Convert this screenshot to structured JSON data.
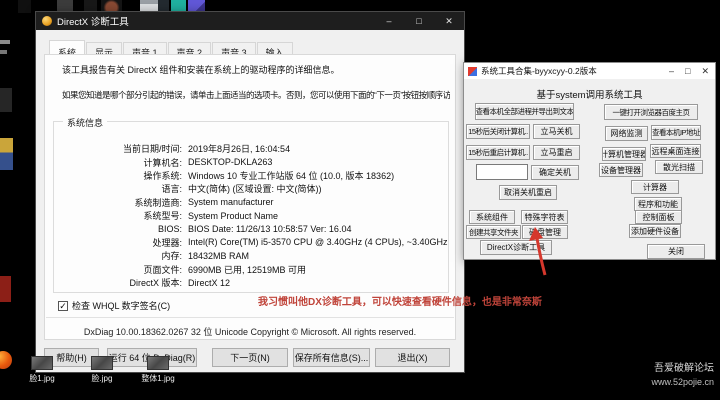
{
  "desktop": {
    "files": [
      "脸1.jpg",
      "脸.jpg",
      "整体1.jpg"
    ],
    "watermark": {
      "line1": "吾爱破解论坛",
      "line2": "www.52pojie.cn"
    }
  },
  "dxdiag": {
    "title": "DirectX 诊断工具",
    "window_controls": {
      "minimize": "–",
      "maximize": "□",
      "close": "✕"
    },
    "tabs": [
      "系统",
      "显示",
      "声音 1",
      "声音 2",
      "声音 3",
      "输入"
    ],
    "intro1": "该工具报告有关 DirectX 组件和安装在系统上的驱动程序的详细信息。",
    "intro2": "如果您知道是哪个部分引起的错误，请单击上面适当的选项卡。否则，您可以使用下面的“下一页”按钮按顺序访问每一页。",
    "group_title": "系统信息",
    "info_rows": [
      {
        "label": "当前日期/时间:",
        "value": "2019年8月26日, 16:04:54"
      },
      {
        "label": "计算机名:",
        "value": "DESKTOP-DKLA263"
      },
      {
        "label": "操作系统:",
        "value": "Windows 10 专业工作站版 64 位 (10.0, 版本 18362)"
      },
      {
        "label": "语言:",
        "value": "中文(简体) (区域设置: 中文(简体))"
      },
      {
        "label": "系统制造商:",
        "value": "System manufacturer"
      },
      {
        "label": "系统型号:",
        "value": "System Product Name"
      },
      {
        "label": "BIOS:",
        "value": "BIOS Date: 11/26/13 10:58:57 Ver: 16.04"
      },
      {
        "label": "处理器:",
        "value": "Intel(R) Core(TM) i5-3570 CPU @ 3.40GHz (4 CPUs), ~3.40GHz"
      },
      {
        "label": "内存:",
        "value": "18432MB RAM"
      },
      {
        "label": "页面文件:",
        "value": "6990MB 已用, 12519MB 可用"
      },
      {
        "label": "DirectX 版本:",
        "value": "DirectX 12"
      }
    ],
    "whql": {
      "mark": "✓",
      "label": "检查 WHQL 数字签名(C)"
    },
    "status_line": "DxDiag 10.00.18362.0267 32 位 Unicode  Copyright © Microsoft. All rights reserved.",
    "buttons": [
      "帮助(H)",
      "运行 64 位 DxDiag(R)",
      "下一页(N)",
      "保存所有信息(S)...",
      "退出(X)"
    ]
  },
  "toolbox": {
    "title": "系统工具合集-byyxcyy-0.2版本",
    "window_controls": {
      "minimize": "–",
      "maximize": "□",
      "close": "✕"
    },
    "header": "基于system调用系统工具",
    "buttons": {
      "view_processes": "查看本机全部进程并导出到文本",
      "open_browser_home": "一键打开浏览器百度主页",
      "shutdown_15s": "15秒后关闭计算机..",
      "shutdown_now": "立马关机",
      "network_monitor": "网络监测",
      "view_ip": "查看本机IP地址",
      "restart_15s": "15秒后重启计算机..",
      "restart_now": "立马重启",
      "computer_mgmt": "计算机管理器",
      "remote_desktop": "远程桌面连接",
      "confirm_shutdown": "确定关机",
      "device_manager": "设备管理器",
      "light_scan": "散光扫描",
      "calculator": "计算器",
      "cancel_shutdown": "取消关机重启",
      "programs_features": "程序和功能",
      "system_components": "系统组件",
      "special_chars": "特殊字符表",
      "control_panel": "控制面板",
      "create_shared_folder": "创建共享文件夹",
      "disk_mgmt": "磁盘管理",
      "add_hardware": "添加硬件设备",
      "dxdiag_tool": "DirectX诊断工具",
      "close": "关闭"
    }
  },
  "annotation": {
    "text": "我习惯叫他DX诊断工具，可以快速查看硬件信息，也是非常奈斯",
    "color": "#c0443a",
    "arrow_color": "#d5372c"
  }
}
